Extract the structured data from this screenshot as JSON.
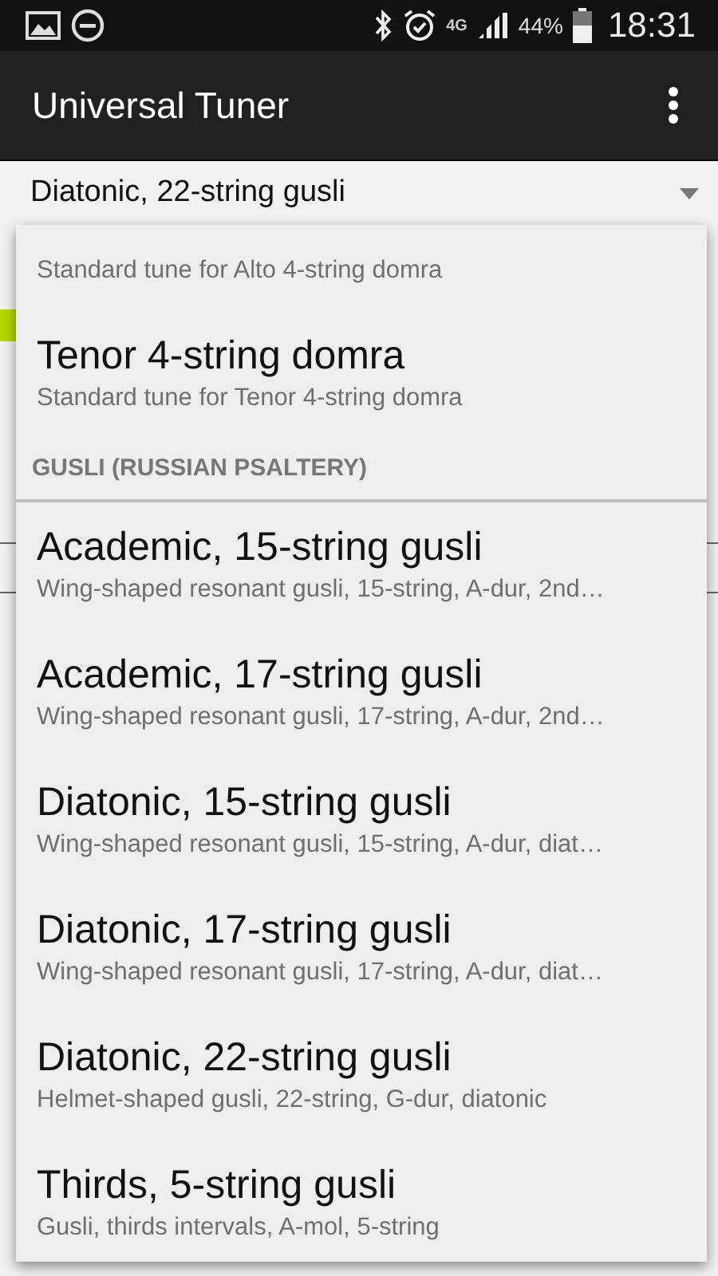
{
  "status_bar": {
    "network": "4G",
    "battery": "44%",
    "time": "18:31"
  },
  "app_bar": {
    "title": "Universal Tuner"
  },
  "spinner": {
    "value": "Diatonic, 22-string gusli"
  },
  "dropdown": [
    {
      "kind": "item",
      "subtitle": "Standard tune for Alto 4-string domra"
    },
    {
      "kind": "item",
      "title": "Tenor 4-string domra",
      "subtitle": "Standard tune for Tenor 4-string domra"
    },
    {
      "kind": "header",
      "title": "GUSLI (RUSSIAN PSALTERY)"
    },
    {
      "kind": "item",
      "title": "Academic, 15-string gusli",
      "subtitle": "Wing-shaped resonant gusli, 15-string, A-dur, 2nd…"
    },
    {
      "kind": "item",
      "title": "Academic, 17-string gusli",
      "subtitle": "Wing-shaped resonant gusli, 17-string, A-dur, 2nd…"
    },
    {
      "kind": "item",
      "title": "Diatonic, 15-string gusli",
      "subtitle": "Wing-shaped resonant gusli, 15-string, A-dur, diat…"
    },
    {
      "kind": "item",
      "title": "Diatonic, 17-string gusli",
      "subtitle": "Wing-shaped resonant gusli, 17-string, A-dur, diat…"
    },
    {
      "kind": "item",
      "title": "Diatonic, 22-string gusli",
      "subtitle": "Helmet-shaped gusli, 22-string, G-dur, diatonic"
    },
    {
      "kind": "item",
      "title": "Thirds, 5-string gusli",
      "subtitle": "Gusli, thirds intervals, A-mol, 5-string"
    }
  ]
}
